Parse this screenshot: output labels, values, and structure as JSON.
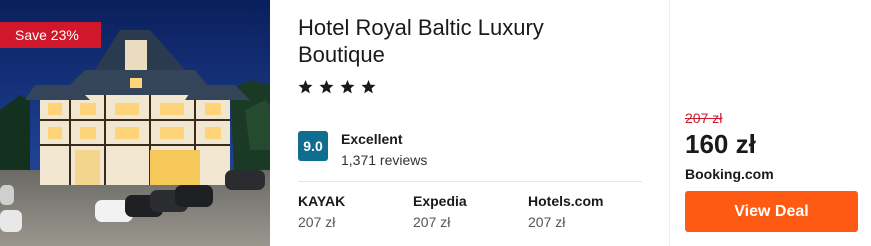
{
  "badge": {
    "text": "Save 23%"
  },
  "hotel": {
    "name": "Hotel Royal Baltic Luxury Boutique",
    "star_count": 4
  },
  "rating": {
    "score": "9.0",
    "label": "Excellent",
    "reviews": "1,371 reviews"
  },
  "providers": [
    {
      "name": "KAYAK",
      "price": "207 zł"
    },
    {
      "name": "Expedia",
      "price": "207 zł"
    },
    {
      "name": "Hotels.com",
      "price": "207 zł"
    }
  ],
  "deal": {
    "old_price": "207 zł",
    "price": "160 zł",
    "provider": "Booking.com",
    "button_label": "View Deal"
  },
  "colors": {
    "badge_red": "#d0172b",
    "score_teal": "#0f6d8f",
    "cta_orange": "#ff5a13",
    "strike_red": "#d0172b"
  },
  "icons": [
    "star-icon"
  ]
}
